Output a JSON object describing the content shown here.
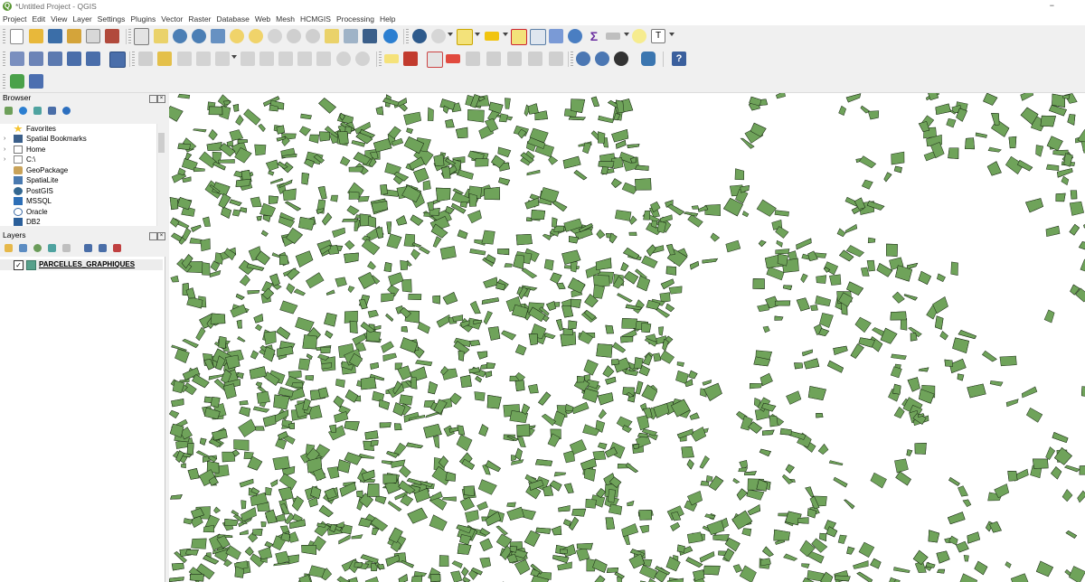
{
  "window": {
    "title": "*Untitled Project - QGIS",
    "minimize_glyph": "−"
  },
  "menu": [
    "Project",
    "Edit",
    "View",
    "Layer",
    "Settings",
    "Plugins",
    "Vector",
    "Raster",
    "Database",
    "Web",
    "Mesh",
    "HCMGIS",
    "Processing",
    "Help"
  ],
  "browser": {
    "title": "Browser",
    "items": [
      {
        "label": "Favorites",
        "icon": "star-icon",
        "expandable": false
      },
      {
        "label": "Spatial Bookmarks",
        "icon": "bookmarks-icon",
        "expandable": true
      },
      {
        "label": "Home",
        "icon": "home-folder-icon",
        "expandable": true
      },
      {
        "label": "C:\\",
        "icon": "folder-icon",
        "expandable": true
      },
      {
        "label": "GeoPackage",
        "icon": "geopackage-icon",
        "expandable": false
      },
      {
        "label": "SpatiaLite",
        "icon": "spatialite-icon",
        "expandable": false
      },
      {
        "label": "PostGIS",
        "icon": "postgis-icon",
        "expandable": false
      },
      {
        "label": "MSSQL",
        "icon": "mssql-icon",
        "expandable": false
      },
      {
        "label": "Oracle",
        "icon": "oracle-icon",
        "expandable": false
      },
      {
        "label": "DB2",
        "icon": "db2-icon",
        "expandable": false
      }
    ]
  },
  "layers": {
    "title": "Layers",
    "items": [
      {
        "name": "PARCELLES_GRAPHIQUES",
        "checked": true,
        "fill": "#56a08b"
      }
    ]
  },
  "map": {
    "layer_fill": "#6fa35a",
    "stroke": "#1a2a14",
    "background": "#ffffff"
  },
  "colors": {
    "qgis_green": "#589632"
  }
}
